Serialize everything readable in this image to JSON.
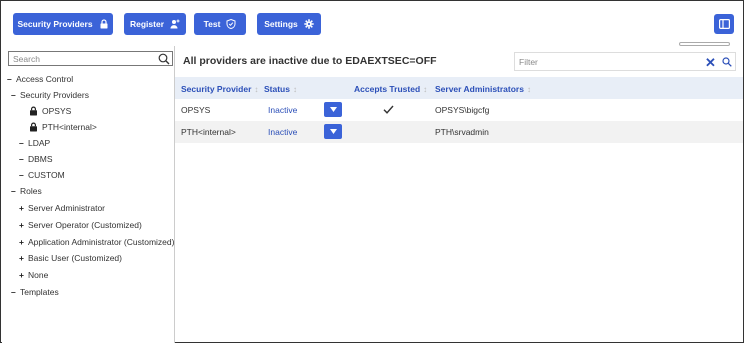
{
  "toolbar": {
    "buttons": [
      {
        "label": "Security Providers",
        "icon": "lock-icon"
      },
      {
        "label": "Register",
        "icon": "add-user-icon"
      },
      {
        "label": "Test",
        "icon": "shield-check-icon"
      },
      {
        "label": "Settings",
        "icon": "gear-icon"
      }
    ],
    "panel_toggle_icon": "sidebar-toggle-icon"
  },
  "sidebar": {
    "search_placeholder": "Search",
    "tree": [
      {
        "label": "Access Control",
        "symbol": "–"
      },
      {
        "label": "Security Providers",
        "symbol": "–"
      },
      {
        "label": "OPSYS",
        "icon": "lock-icon"
      },
      {
        "label": "PTH<internal>",
        "icon": "lock-icon"
      },
      {
        "label": "LDAP",
        "symbol": "–"
      },
      {
        "label": "DBMS",
        "symbol": "–"
      },
      {
        "label": "CUSTOM",
        "symbol": "–"
      },
      {
        "label": "Roles",
        "symbol": "–"
      },
      {
        "label": "Server Administrator",
        "symbol": "+"
      },
      {
        "label": "Server Operator (Customized)",
        "symbol": "+"
      },
      {
        "label": "Application Administrator (Customized)",
        "symbol": "+"
      },
      {
        "label": "Basic User (Customized)",
        "symbol": "+"
      },
      {
        "label": "None",
        "symbol": "+"
      },
      {
        "label": "Templates",
        "symbol": "–"
      }
    ]
  },
  "main": {
    "message": "All providers are inactive due to EDAEXTSEC=OFF",
    "filter_placeholder": "Filter",
    "columns": [
      "Security Provider",
      "Status",
      "Accepts Trusted",
      "Server Administrators"
    ],
    "rows": [
      {
        "provider": "OPSYS",
        "status": "Inactive",
        "accepts_trusted": true,
        "admins": "OPSYS\\bigcfg"
      },
      {
        "provider": "PTH<internal>",
        "status": "Inactive",
        "accepts_trusted": false,
        "admins": "PTH\\srvadmin"
      }
    ]
  },
  "colors": {
    "accent": "#3b63d8",
    "link": "#2b4fb8",
    "header_bg": "#e8eef7"
  }
}
